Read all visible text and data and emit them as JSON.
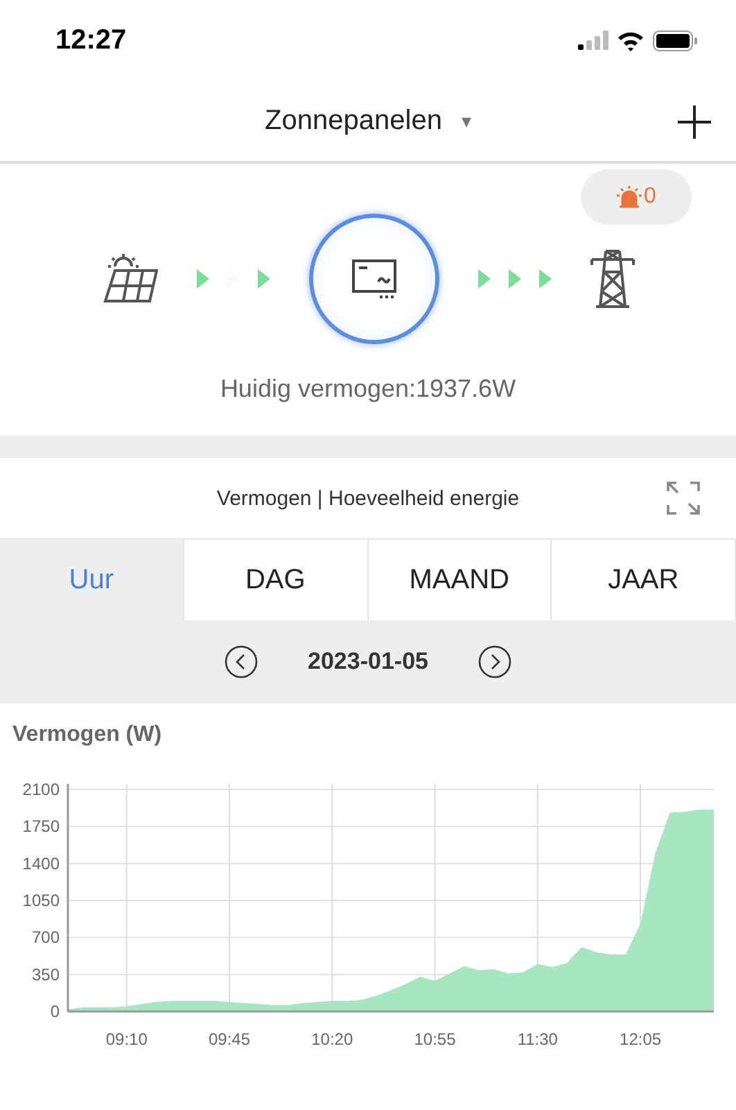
{
  "status_bar": {
    "time": "12:27"
  },
  "header": {
    "title": "Zonnepanelen",
    "dropdown_icon": "▾"
  },
  "alarm": {
    "count": "0"
  },
  "flow": {
    "inbound": [
      {
        "lit": true
      },
      {
        "lit": false
      },
      {
        "lit": true
      }
    ],
    "outbound": [
      {
        "lit": true
      },
      {
        "lit": true
      },
      {
        "lit": true
      }
    ],
    "inverter_active": true,
    "current_power": "Huidig vermogen:1937.6W"
  },
  "chart_card": {
    "title": "Vermogen | Hoeveelheid energie",
    "tabs": [
      {
        "label": "Uur",
        "selected": true
      },
      {
        "label": "DAG",
        "selected": false
      },
      {
        "label": "MAAND",
        "selected": false
      },
      {
        "label": "JAAR",
        "selected": false
      }
    ],
    "date": "2023-01-05",
    "chart_data": {
      "type": "area",
      "title": "Vermogen (W)",
      "x": [
        530,
        535,
        540,
        545,
        550,
        555,
        560,
        565,
        570,
        575,
        580,
        585,
        590,
        595,
        600,
        605,
        610,
        615,
        620,
        625,
        630,
        635,
        640,
        645,
        650,
        655,
        660,
        665,
        670,
        675,
        680,
        685,
        690,
        695,
        700,
        705,
        710,
        715,
        720,
        725,
        730,
        735,
        740,
        745,
        750
      ],
      "series": [
        {
          "color": "#a8e6c0",
          "values": [
            20,
            40,
            40,
            40,
            50,
            70,
            90,
            100,
            100,
            100,
            100,
            90,
            80,
            70,
            60,
            60,
            80,
            90,
            100,
            100,
            110,
            150,
            200,
            260,
            330,
            290,
            360,
            430,
            390,
            400,
            360,
            370,
            450,
            420,
            460,
            610,
            560,
            540,
            540,
            830,
            1490,
            1880,
            1890,
            1910,
            1910
          ]
        }
      ],
      "xlim": [
        530,
        750
      ],
      "ylim": [
        0,
        2100
      ],
      "yticks": [
        0,
        350,
        700,
        1050,
        1400,
        1750,
        2100
      ],
      "xticks": [
        {
          "value": 550,
          "label": "09:10"
        },
        {
          "value": 585,
          "label": "09:45"
        },
        {
          "value": 620,
          "label": "10:20"
        },
        {
          "value": 655,
          "label": "10:55"
        },
        {
          "value": 690,
          "label": "11:30"
        },
        {
          "value": 725,
          "label": "12:05"
        }
      ],
      "grid": true
    }
  }
}
